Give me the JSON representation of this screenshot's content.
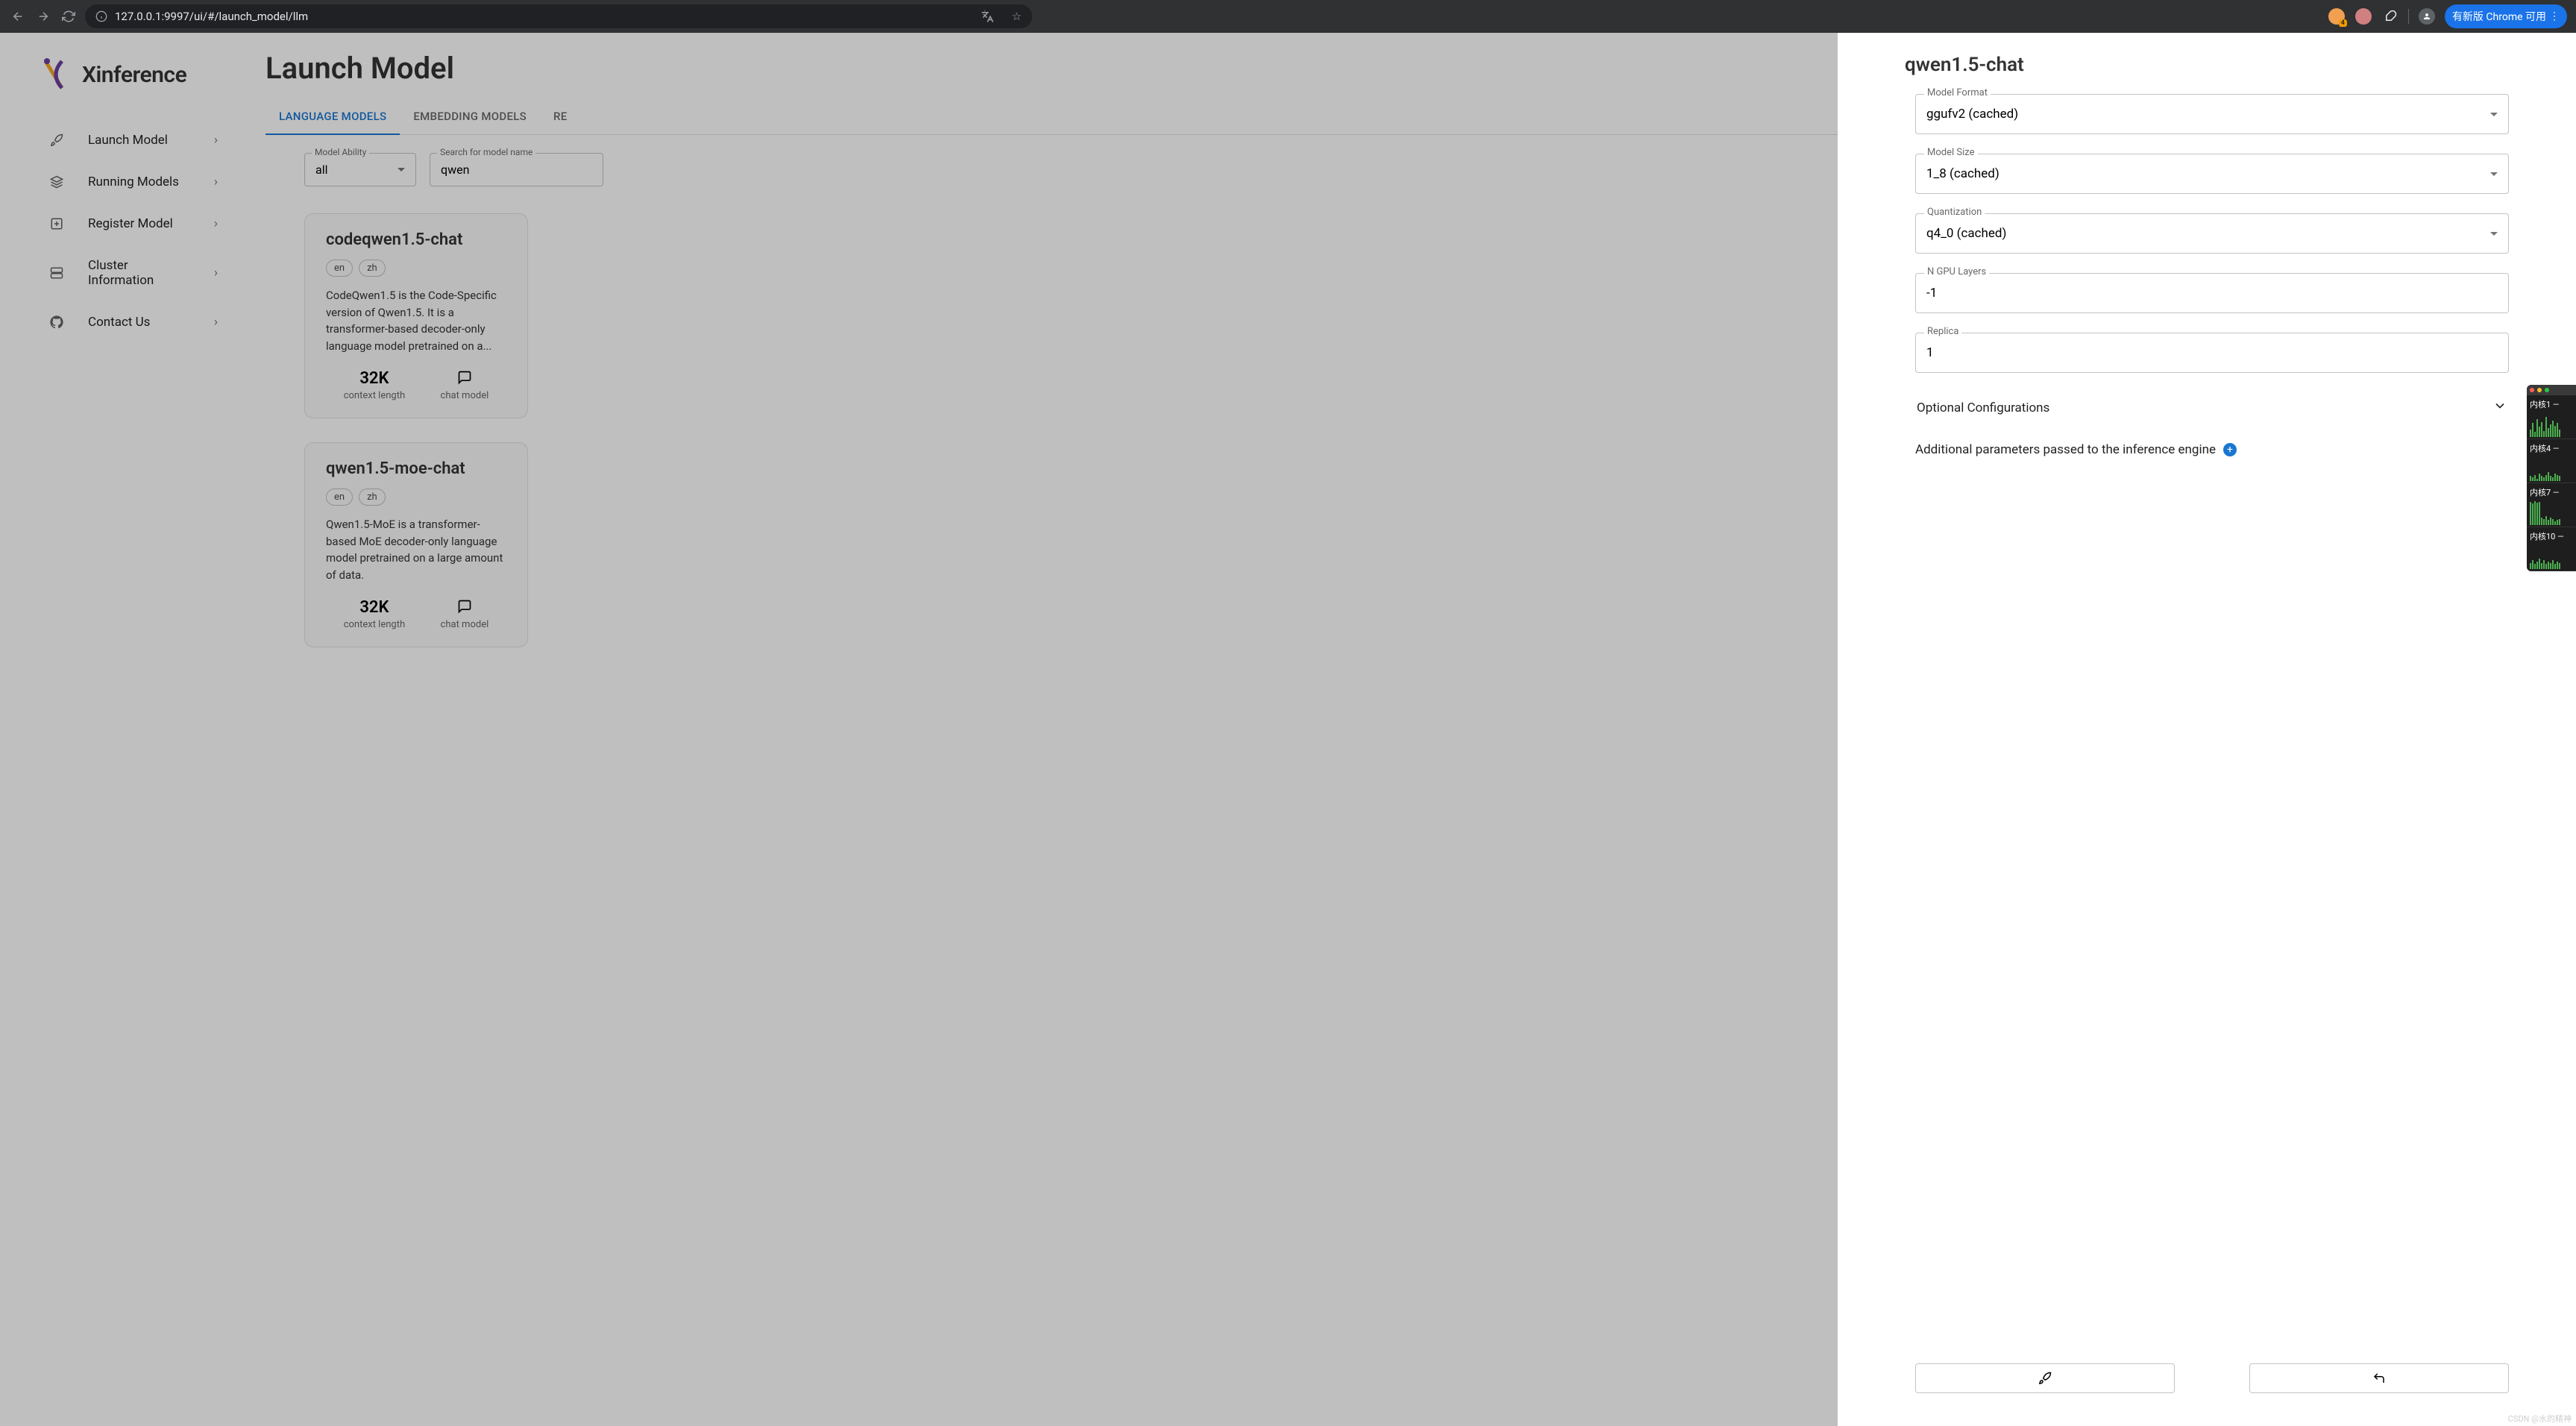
{
  "browser": {
    "url": "127.0.0.1:9997/ui/#/launch_model/llm",
    "update_label": "有新版 Chrome 可用",
    "badge_count": "4"
  },
  "brand": {
    "name": "Xinference"
  },
  "sidebar": {
    "items": [
      {
        "label": "Launch Model"
      },
      {
        "label": "Running Models"
      },
      {
        "label": "Register Model"
      },
      {
        "label": "Cluster Information"
      },
      {
        "label": "Contact Us"
      }
    ]
  },
  "page": {
    "title": "Launch Model",
    "tabs": [
      {
        "label": "LANGUAGE MODELS",
        "active": true
      },
      {
        "label": "EMBEDDING MODELS"
      },
      {
        "label": "RE"
      }
    ],
    "filter": {
      "ability_label": "Model Ability",
      "ability_value": "all",
      "search_label": "Search for model name",
      "search_value": "qwen"
    },
    "cards": [
      {
        "name": "codeqwen1.5-chat",
        "langs": [
          "en",
          "zh"
        ],
        "desc": "CodeQwen1.5 is the Code-Specific version of Qwen1.5. It is a transformer-based decoder-only language model pretrained on a...",
        "context": "32K",
        "context_label": "context length",
        "type_label": "chat model"
      },
      {
        "name": "qwen1.5-moe-chat",
        "langs": [
          "en",
          "zh"
        ],
        "desc": "Qwen1.5-MoE is a transformer-based MoE decoder-only language model pretrained on a large amount of data.",
        "context": "32K",
        "context_label": "context length",
        "type_label": "chat model"
      }
    ]
  },
  "drawer": {
    "title": "qwen1.5-chat",
    "fields": {
      "format_label": "Model Format",
      "format_value": "ggufv2 (cached)",
      "size_label": "Model Size",
      "size_value": "1_8 (cached)",
      "quant_label": "Quantization",
      "quant_value": "q4_0 (cached)",
      "gpu_label": "N GPU Layers",
      "gpu_value": "-1",
      "replica_label": "Replica",
      "replica_value": "1"
    },
    "optional_label": "Optional Configurations",
    "additional_label": "Additional parameters passed to the inference engine"
  },
  "cpu": {
    "rows": [
      "内核1 — ",
      "内核4 — ",
      "内核7 — ",
      "内核10 —"
    ]
  },
  "watermark": "CSDN @水的精神"
}
